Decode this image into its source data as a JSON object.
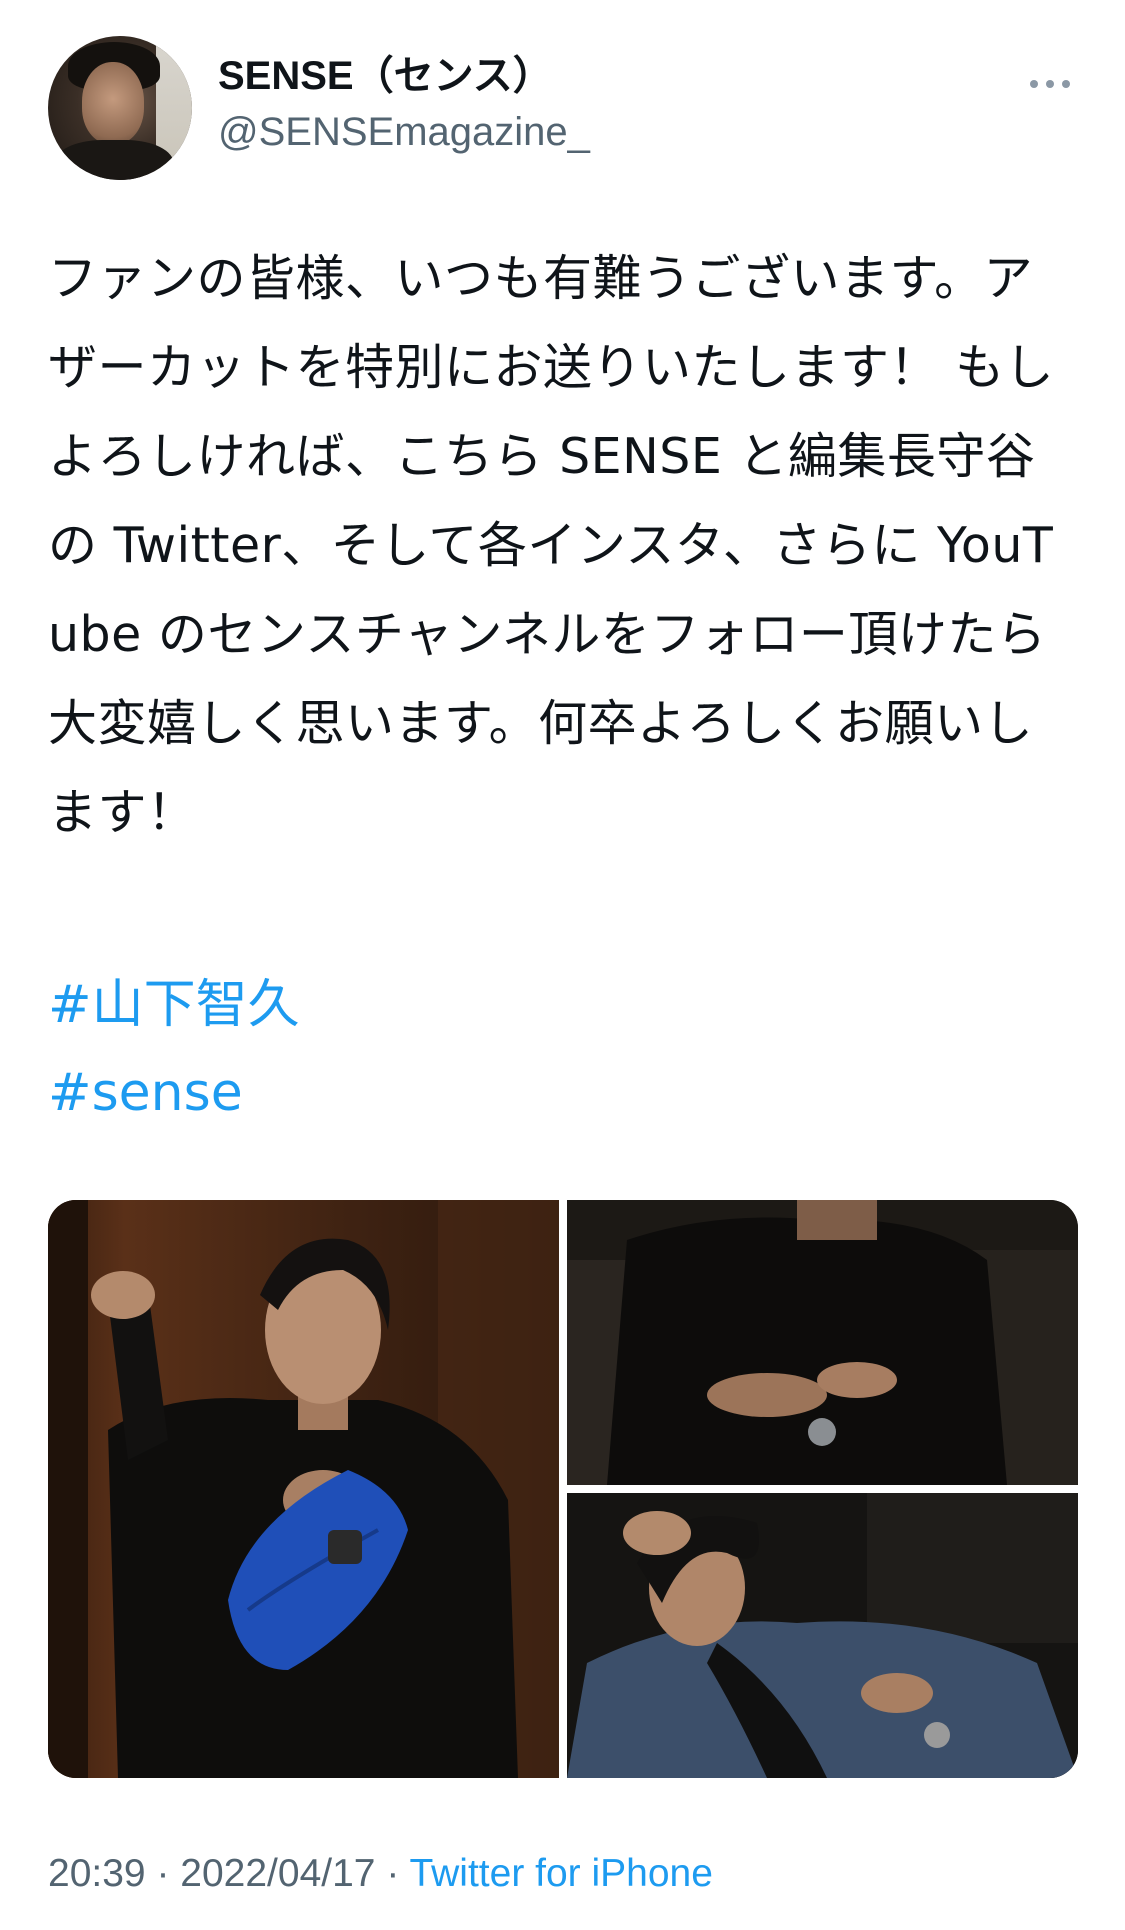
{
  "user": {
    "display_name": "SENSE（センス）",
    "handle": "@SENSEmagazine_"
  },
  "tweet": {
    "text": "ファンの皆様、いつも有難うございます。アザーカットを特別にお送りいたします！ もしよろしければ、こちら SENSE と編集長守谷の Twitter、そして各インスタ、さらに YouTube のセンスチャンネルをフォロー頂けたら大変嬉しく思います。何卒よろしくお願いします！",
    "hashtags": [
      "#山下智久",
      "#sense"
    ]
  },
  "meta": {
    "time": "20:39",
    "separator": " · ",
    "date": "2022/04/17",
    "source": "Twitter for iPhone"
  },
  "icons": {
    "more": "more-horizontal-icon"
  },
  "colors": {
    "link": "#1d9bf0",
    "secondary_text": "#536471",
    "primary_text": "#0f1419"
  }
}
